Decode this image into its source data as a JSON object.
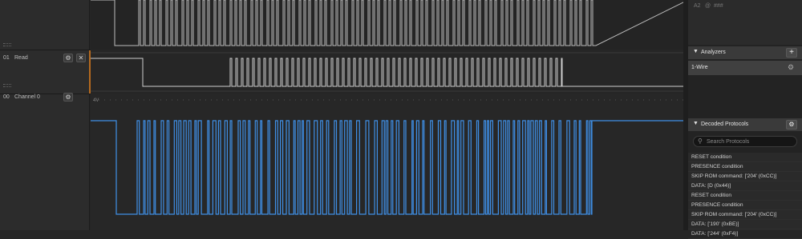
{
  "channels": [
    {
      "index": "01",
      "name": "Read"
    },
    {
      "index": "00",
      "name": "Channel 0"
    }
  ],
  "channel0_scale_label": "4V",
  "top_panel": {
    "ref_label": "A2",
    "at": "@",
    "value": "###"
  },
  "analyzers": {
    "title": "Analyzers",
    "add_label": "+",
    "items": [
      {
        "name": "1-Wire"
      }
    ]
  },
  "decoded": {
    "title": "Decoded Protocols",
    "search_placeholder": "Search Protocols",
    "rows": [
      "RESET condition",
      "PRESENCE condition",
      "SKIP ROM command: ['204' (0xCC)]",
      "DATA: [D (0x44)]",
      "RESET condition",
      "PRESENCE condition",
      "SKIP ROM command: ['204' (0xCC)]",
      "DATA: ['190' (0xBE)]",
      "DATA: ['244' (0xF4)]"
    ]
  },
  "colors": {
    "analog_trace": "#3f8fe6",
    "digital_trace": "#cfcfcf",
    "accent": "#c87a2a"
  }
}
